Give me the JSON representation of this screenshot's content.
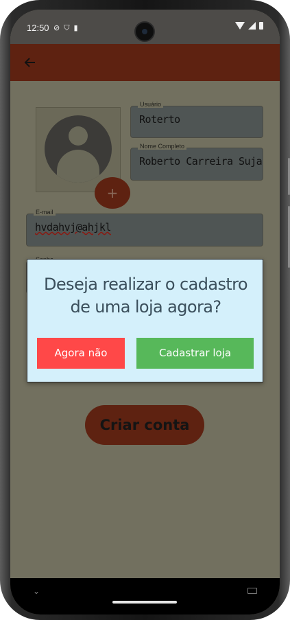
{
  "status_bar": {
    "time": "12:50",
    "left_icons": [
      "do-not-disturb-icon",
      "shield-icon",
      "sim-card-icon"
    ],
    "right_icons": [
      "wifi-icon",
      "signal-icon",
      "battery-icon"
    ]
  },
  "app_bar": {
    "back_icon": "arrow-left-icon",
    "color": "#5e2211"
  },
  "form": {
    "photo_add_label": "+",
    "fields": {
      "username": {
        "label": "Usuário",
        "value": "Roterto"
      },
      "full_name": {
        "label": "Nome Completo",
        "value": "Roberto Carreira Suja"
      },
      "email": {
        "label": "E-mail",
        "value": "hvdahvj@ahjkl"
      },
      "password": {
        "label": "Senha",
        "value": ""
      }
    },
    "create_account_label": "Criar conta"
  },
  "dialog": {
    "message": "Deseja realizar o cadastro de uma loja agora?",
    "cancel_label": "Agora não",
    "confirm_label": "Cadastrar loja",
    "background": "#d4f0fb",
    "cancel_color": "#ff4848",
    "confirm_color": "#57b85a"
  },
  "nav_bar": {
    "left_icon": "chevron-down-icon",
    "right_icon": "keyboard-icon"
  }
}
